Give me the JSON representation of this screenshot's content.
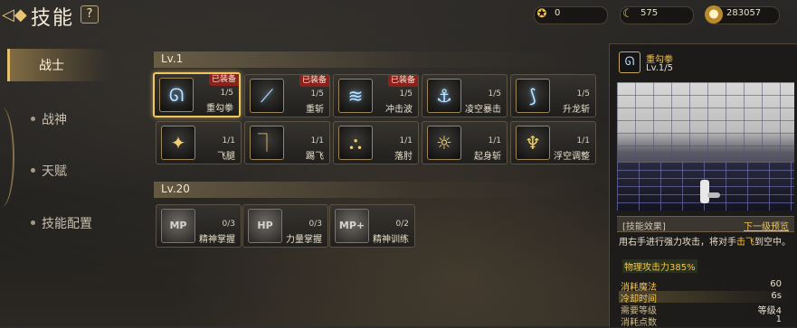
{
  "header": {
    "title": "技能",
    "help_label": "?"
  },
  "currencies": [
    {
      "icon": "diamond-coin-icon",
      "value": "0"
    },
    {
      "icon": "moon-coin-icon",
      "value": "575"
    },
    {
      "icon": "gold-coin-icon",
      "value": "283057"
    }
  ],
  "sidebar": {
    "items": [
      {
        "label": "战士",
        "active": true
      },
      {
        "label": "战神",
        "active": false
      },
      {
        "label": "天赋",
        "active": false
      },
      {
        "label": "技能配置",
        "active": false
      }
    ]
  },
  "sections": [
    {
      "title": "Lv.1",
      "skills": [
        {
          "name": "重勾拳",
          "level": "1/5",
          "equipped_label": "已装备",
          "icon": "uppercut-icon",
          "selected": true
        },
        {
          "name": "重斩",
          "level": "1/5",
          "equipped_label": "已装备",
          "icon": "slash-icon"
        },
        {
          "name": "冲击波",
          "level": "1/5",
          "equipped_label": "已装备",
          "icon": "shockwave-icon"
        },
        {
          "name": "凌空暴击",
          "level": "1/5",
          "icon": "aerial-strike-icon"
        },
        {
          "name": "升龙斩",
          "level": "1/5",
          "icon": "rising-dragon-icon"
        },
        {
          "name": "飞腿",
          "level": "1/1",
          "icon": "flying-kick-icon"
        },
        {
          "name": "踢飞",
          "level": "1/1",
          "icon": "kick-up-icon"
        },
        {
          "name": "落肘",
          "level": "1/1",
          "icon": "elbow-drop-icon"
        },
        {
          "name": "起身斩",
          "level": "1/1",
          "icon": "rising-slash-icon"
        },
        {
          "name": "浮空调整",
          "level": "1/1",
          "icon": "air-adjust-icon"
        }
      ]
    },
    {
      "title": "Lv.20",
      "skills": [
        {
          "name": "精神掌握",
          "level": "0/3",
          "icon": "mp-mastery-icon",
          "icon_text": "MP"
        },
        {
          "name": "力量掌握",
          "level": "0/3",
          "icon": "hp-mastery-icon",
          "icon_text": "HP"
        },
        {
          "name": "精神训练",
          "level": "0/2",
          "icon": "mp-training-icon",
          "icon_text": "MP+"
        }
      ]
    }
  ],
  "detail": {
    "name": "重勾拳",
    "level": "Lv.1/5",
    "effect_label": "[技能效果]",
    "next_level_link": "下一级预览",
    "description_part1": "用右手进行强力攻击，将对手",
    "description_highlight": "击飞",
    "description_part2": "到空中。",
    "damage": "物理攻击力385%",
    "stats": [
      {
        "key": "消耗魔法",
        "value": "60",
        "gold": true
      },
      {
        "key": "冷却时间",
        "value": "6s",
        "gold": true,
        "highlight": true
      },
      {
        "key": "需要等级",
        "value": "等级4",
        "gold": false
      },
      {
        "key": "消耗点数",
        "value": "1",
        "gold": false
      }
    ]
  }
}
